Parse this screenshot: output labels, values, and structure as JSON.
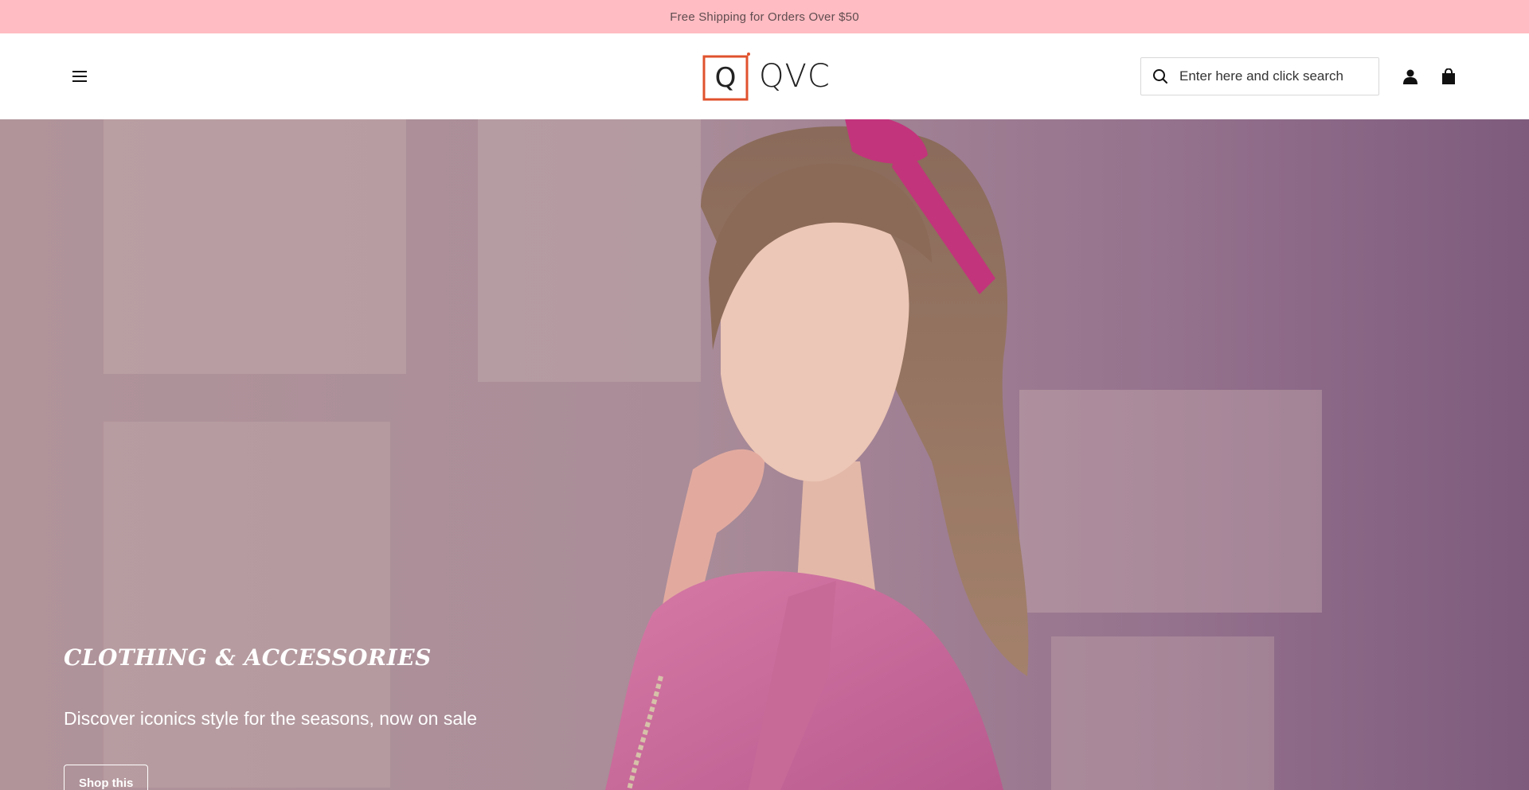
{
  "announcement": {
    "text": "Free Shipping for Orders Over $50"
  },
  "header": {
    "menu_icon": "hamburger-menu-icon",
    "logo_text": "QVC",
    "logo_mark_letter": "Q",
    "search": {
      "placeholder": "Enter here and click search",
      "icon": "search-icon"
    },
    "account_icon": "user-icon",
    "cart_icon": "shopping-bag-icon"
  },
  "hero": {
    "title": "CLOTHING & ACCESSORIES",
    "subtitle": "Discover iconics style for the seasons, now on sale",
    "button_label": "Shop this"
  },
  "colors": {
    "announcement_bg": "#ffbcc2",
    "logo_accent": "#e0522d",
    "hero_tint": "#9d7f92"
  }
}
